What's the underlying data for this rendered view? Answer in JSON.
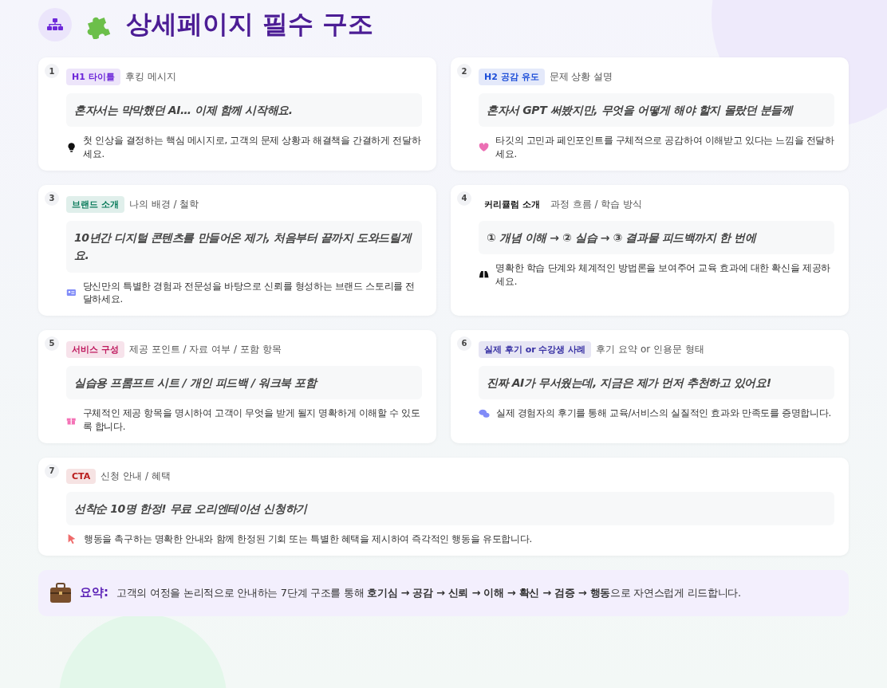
{
  "header": {
    "title": "상세페이지 필수 구조"
  },
  "cards": [
    {
      "number": "1",
      "tag": "H1 타이틀",
      "color": "#6d28d9",
      "subtitle": "후킹 메시지",
      "quote": "혼자서는 막막했던 AI… 이제 함께 시작해요.",
      "kind": "bulb",
      "description": "첫 인상을 결정하는 핵심 메시지로, 고객의 문제 상황과 해결책을 간결하게 전달하세요."
    },
    {
      "number": "2",
      "tag": "H2 공감 유도",
      "color": "#1d4ed8",
      "subtitle": "문제 상황 설명",
      "quote": "혼자서 GPT 써봤지만, 무엇을 어떻게 해야 할지 몰랐던 분들께",
      "kind": "heart",
      "description": "타깃의 고민과 페인포인트를 구체적으로 공감하여 이해받고 있다는 느낌을 전달하세요."
    },
    {
      "number": "3",
      "tag": "브랜드 소개",
      "color": "#047857",
      "subtitle": "나의 배경 / 철학",
      "quote": "10년간 디지털 콘텐츠를 만들어온 제가, 처음부터 끝까지 도와드릴게요.",
      "kind": "idcard",
      "description": "당신만의 특별한 경험과 전문성을 바탕으로 신뢰를 형성하는 브랜드 스토리를 전달하세요."
    },
    {
      "number": "4",
      "tag": "커리큘럼 소개",
      "color": "#111111",
      "subtitle": "과정 흐름 / 학습 방식",
      "quote": "① 개념 이해 → ② 실습 → ③ 결과물 피드백까지 한 번에",
      "kind": "binoculars",
      "description": "명확한 학습 단계와 체계적인 방법론을 보여주어 교육 효과에 대한 확신을 제공하세요."
    },
    {
      "number": "5",
      "tag": "서비스 구성",
      "color": "#be185d",
      "subtitle": "제공 포인트 / 자료 여부 / 포함 항목",
      "quote": "실습용 프롬프트 시트 / 개인 피드백 / 워크북 포함",
      "kind": "gift",
      "description": "구체적인 제공 항목을 명시하여 고객이 무엇을 받게 될지 명확하게 이해할 수 있도록 합니다."
    },
    {
      "number": "6",
      "tag": "실제 후기 or 수강생 사례",
      "color": "#3730a3",
      "subtitle": "후기 요약 or 인용문 형태",
      "quote": "진짜 AI가 무서웠는데, 지금은 제가 먼저 추천하고 있어요!",
      "kind": "chat",
      "description": "실제 경험자의 후기를 통해 교육/서비스의 실질적인 효과와 만족도를 증명합니다."
    },
    {
      "number": "7",
      "tag": "CTA",
      "color": "#b91c1c",
      "subtitle": "신청 안내 / 혜택",
      "quote": "선착순 10명 한정! 무료 오리엔테이션 신청하기",
      "kind": "pointer",
      "description": "행동을 촉구하는 명확한 안내와 함께 한정된 기회 또는 특별한 혜택을 제시하여 즉각적인 행동을 유도합니다."
    }
  ],
  "summary": {
    "label": "요약:",
    "text": "고객의 여정을 논리적으로 안내하는 7단계 구조를 통해 **호기심 → 공감 → 신뢰 → 이해 → 확신 → 검증 → 행동**으로 자연스럽게 리드합니다."
  }
}
